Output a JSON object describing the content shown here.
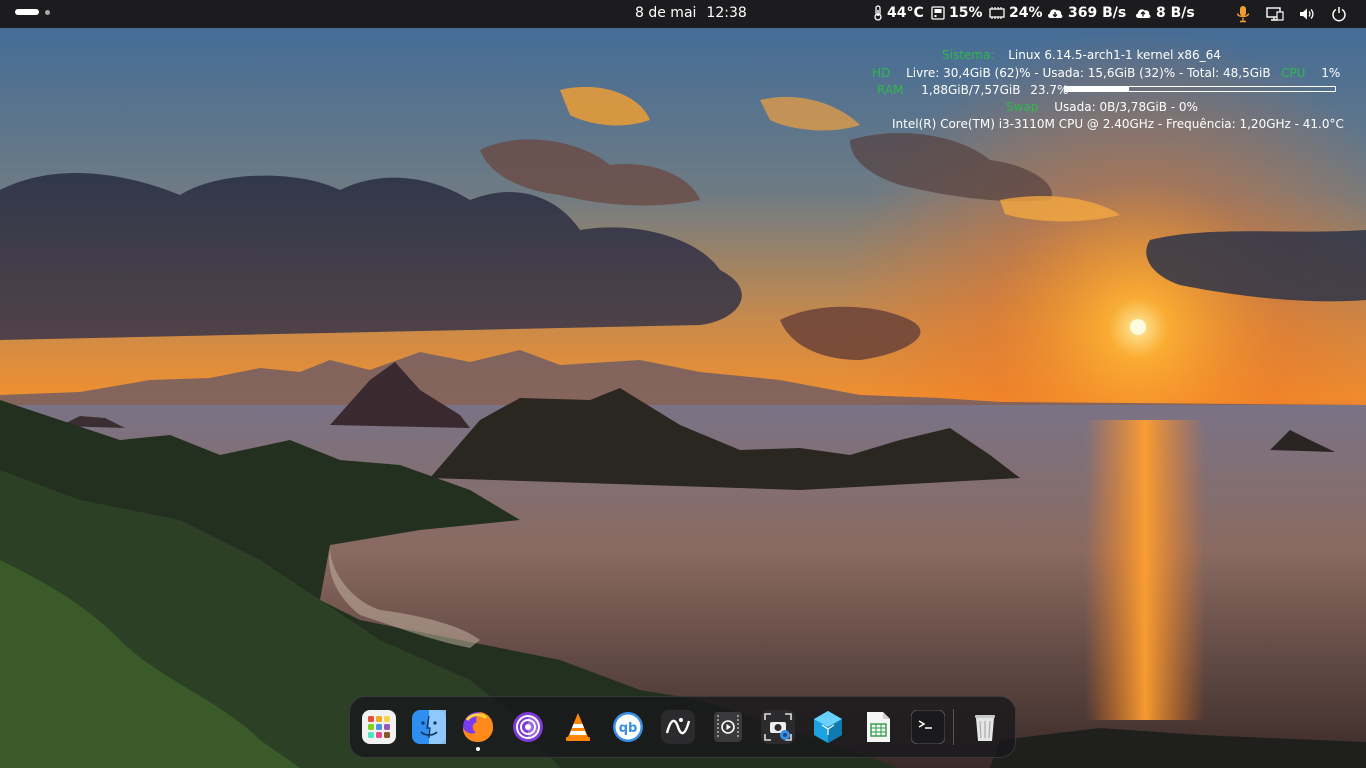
{
  "topbar": {
    "date": "8 de mai",
    "time": "12:38",
    "temperature": "44°C",
    "disk_usage": "15%",
    "memory_usage": "24%",
    "download_rate": "369 B/s",
    "upload_rate": "8 B/s",
    "icons": [
      "thermometer-icon",
      "disk-icon",
      "memory-icon",
      "cloud-download-icon",
      "cloud-upload-icon",
      "microphone-icon",
      "display-settings-icon",
      "volume-icon",
      "power-icon"
    ]
  },
  "conky": {
    "system_label": "Sistema:",
    "system_value": "Linux 6.14.5-arch1-1 kernel x86_64",
    "hd_label": "HD",
    "hd_value": "Livre: 30,4GiB (62)% - Usada: 15,6GiB (32)% - Total: 48,5GiB",
    "cpu_label": "CPU",
    "cpu_value": "1%",
    "ram_label": "RAM",
    "ram_value": "1,88GiB/7,57GiB",
    "ram_percent": "23.7%",
    "ram_fraction": 0.237,
    "swap_label": "Swap",
    "swap_value": "Usada:  0B/3,78GiB - 0%",
    "cpu_info": "Intel(R) Core(TM) i3-3110M CPU @ 2.40GHz - Frequência: 1,20GHz - 41.0°C"
  },
  "dock": {
    "apps": [
      "app-grid-icon",
      "finder-icon",
      "firefox-icon",
      "tor-browser-icon",
      "vlc-icon",
      "qbittorrent-icon",
      "app-6-icon",
      "video-player-icon",
      "screenshot-icon",
      "crystal-app-icon",
      "document-viewer-icon",
      "terminal-icon",
      "trash-icon"
    ]
  },
  "colors": {
    "accent_green": "#2fb84a",
    "topbar_bg": "#1c1c1e",
    "mic_orange": "#f0a030"
  }
}
